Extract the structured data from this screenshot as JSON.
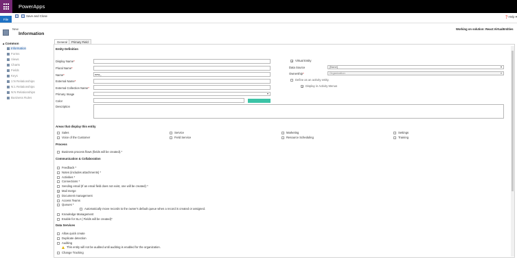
{
  "app": {
    "name": "PowerApps"
  },
  "ribbon": {
    "file": "File",
    "save_close": "Save and Close",
    "help": "Help"
  },
  "header": {
    "crumb": "New",
    "title": "Information",
    "solution": "Working on solution: React.VirtualEntities"
  },
  "sidebar": {
    "heading": "Common",
    "items": [
      {
        "label": "Information",
        "icon": "info-icon"
      },
      {
        "label": "Forms",
        "icon": "form-icon"
      },
      {
        "label": "Views",
        "icon": "view-icon"
      },
      {
        "label": "Charts",
        "icon": "chart-icon"
      },
      {
        "label": "Fields",
        "icon": "field-icon"
      },
      {
        "label": "Keys",
        "icon": "key-icon"
      },
      {
        "label": "1:N Relationships",
        "icon": "relationship-icon"
      },
      {
        "label": "N:1 Relationships",
        "icon": "relationship-icon"
      },
      {
        "label": "N:N Relationships",
        "icon": "relationship-icon"
      },
      {
        "label": "Business Rules",
        "icon": "rule-icon"
      }
    ]
  },
  "tabs": [
    "General",
    "Primary Field"
  ],
  "entity_definition": {
    "heading": "Entity Definition",
    "display_name": "Display Name",
    "plural_name": "Plural Name",
    "name": "Name",
    "name_value": "new_",
    "external_name": "External Name",
    "external_collection_name": "External Collection Name",
    "primary_image": "Primary Image",
    "color": "Color",
    "description": "Description",
    "virtual_entity": "Virtual Entity",
    "data_source": "Data Source",
    "data_source_value": "[None]",
    "ownership": "Ownership",
    "ownership_value": "Organization",
    "define_activity": "Define as an activity entity.",
    "display_activity_menus": "Display in Activity Menus",
    "color_swatch": "#3cc3a6"
  },
  "areas": {
    "heading": "Areas that display this entity",
    "items": [
      "Sales",
      "Service",
      "Marketing",
      "Settings",
      "Voice of the Customer",
      "Field Service",
      "Resource Scheduling",
      "Training"
    ]
  },
  "process": {
    "heading": "Process",
    "item": "Business process flows (fields will be created).*"
  },
  "comm": {
    "heading": "Communication & Collaboration",
    "items": [
      "Feedback *",
      "Notes (includes attachments) *",
      "Activities *",
      "Connections *",
      "Sending email (If an email field does not exist, one will be created) *",
      "Mail merge",
      "Document management",
      "Access Teams",
      "Queues *"
    ],
    "queue_sub": "Automatically move records to the owner's default queue when a record is created or assigned.",
    "more": [
      "Knowledge Management",
      "Enable for SLA ( Fields will be created)*"
    ]
  },
  "data_services": {
    "heading": "Data Services",
    "items": [
      "Allow quick create",
      "Duplicate detection",
      "Auditing"
    ],
    "audit_warning": "This entity will not be audited until auditing is enabled for the organization.",
    "change_tracking": "Change Tracking"
  }
}
